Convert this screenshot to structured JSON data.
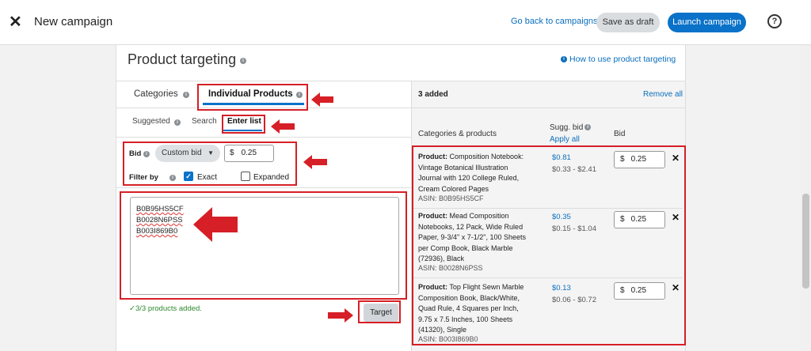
{
  "topbar": {
    "title": "New campaign",
    "back_link": "Go back to campaigns",
    "draft_button": "Save as draft",
    "launch_button": "Launch campaign",
    "help_icon": "?"
  },
  "card": {
    "title": "Product targeting",
    "howto_link": "How to use product targeting"
  },
  "tabs": [
    {
      "label": "Categories"
    },
    {
      "label": "Individual Products"
    }
  ],
  "subtabs": [
    {
      "label": "Suggested"
    },
    {
      "label": "Search"
    },
    {
      "label": "Enter list"
    }
  ],
  "bid": {
    "label": "Bid",
    "dropdown": "Custom bid",
    "currency": "$",
    "value": "0.25"
  },
  "filter": {
    "label": "Filter by",
    "exact": "Exact",
    "expanded": "Expanded",
    "exact_checked": true,
    "expanded_checked": false
  },
  "asin_list": [
    "B0B95HS5CF",
    "B0028N6PSS",
    "B003I869B0"
  ],
  "added_message": "3/3 products added.",
  "target_button": "Target",
  "right": {
    "added_count": "3 added",
    "remove_all": "Remove all",
    "col_products": "Categories & products",
    "col_sugg": "Sugg. bid",
    "apply_all": "Apply all",
    "col_bid": "Bid",
    "products": [
      {
        "prefix": "Product:",
        "name": "Composition Notebook: Vintage Botanical Illustration Journal with 120 College Ruled, Cream Colored Pages",
        "asin": "ASIN: B0B95HS5CF",
        "sugg": "$0.81",
        "range": "$0.33 - $2.41",
        "currency": "$",
        "bid": "0.25"
      },
      {
        "prefix": "Product:",
        "name": "Mead Composition Notebooks, 12 Pack, Wide Ruled Paper, 9-3/4\" x 7-1/2\", 100 Sheets per Comp Book, Black Marble (72936), Black",
        "asin": "ASIN: B0028N6PSS",
        "sugg": "$0.35",
        "range": "$0.15 - $1.04",
        "currency": "$",
        "bid": "0.25"
      },
      {
        "prefix": "Product:",
        "name": "Top Flight Sewn Marble Composition Book, Black/White, Quad Rule, 4 Squares per Inch, 9.75 x 7.5 Inches, 100 Sheets (41320), Single",
        "asin": "ASIN: B003I869B0",
        "sugg": "$0.13",
        "range": "$0.06 - $0.72",
        "currency": "$",
        "bid": "0.25"
      }
    ]
  },
  "colors": {
    "accent": "#0a72c8",
    "link": "#0a6ebd",
    "annotation": "#d61f26",
    "success": "#2e8a2e"
  }
}
